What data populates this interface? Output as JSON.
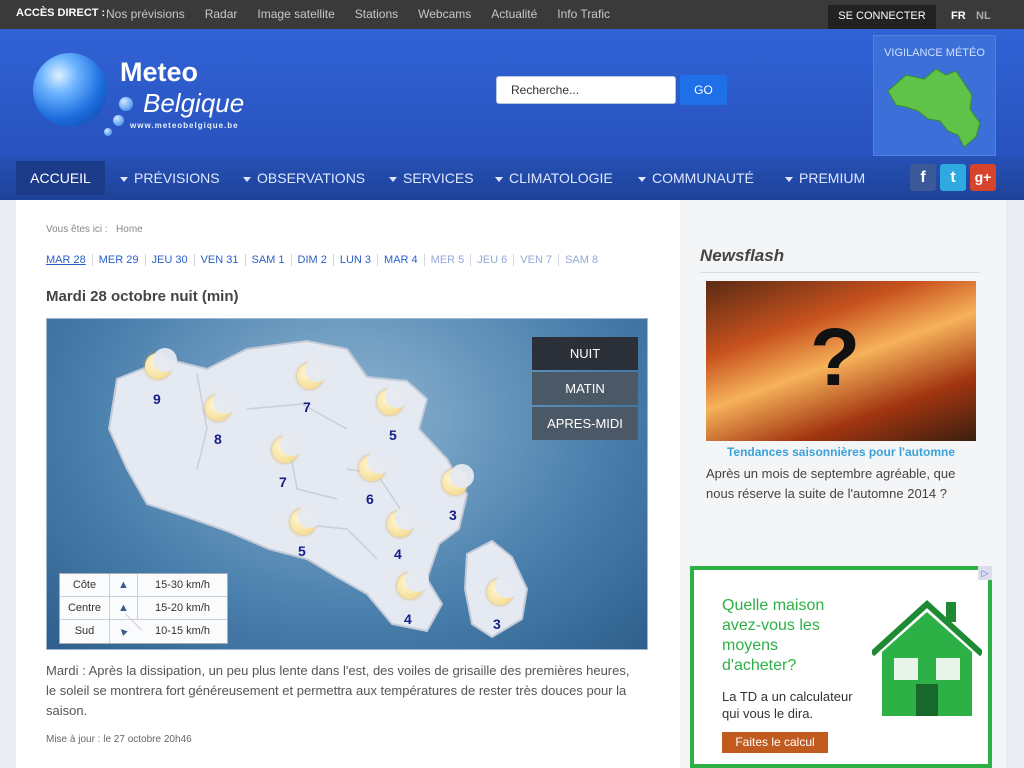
{
  "topbar": {
    "label": "ACCÈS DIRECT :",
    "links": [
      "Nos prévisions",
      "Radar",
      "Image satellite",
      "Stations",
      "Webcams",
      "Actualité",
      "Info Trafic"
    ],
    "login": "SE CONNECTER",
    "lang_fr": "FR",
    "lang_nl": "NL"
  },
  "header": {
    "logo_line1": "Meteo",
    "logo_line2": "Belgique",
    "logo_url": "www.meteobelgique.be",
    "search_placeholder": "Recherche...",
    "search_button": "GO",
    "vigilance": "VIGILANCE MÉTÉO"
  },
  "nav": {
    "home": "ACCUEIL",
    "items": [
      "PRÉVISIONS",
      "OBSERVATIONS",
      "SERVICES",
      "CLIMATOLOGIE",
      "COMMUNAUTÉ",
      "PREMIUM"
    ]
  },
  "breadcrumb": {
    "label": "Vous êtes ici :",
    "page": "Home"
  },
  "days": [
    "MAR 28",
    "MER 29",
    "JEU 30",
    "VEN 31",
    "SAM 1",
    "DIM 2",
    "LUN 3",
    "MAR 4",
    "MER 5",
    "JEU 6",
    "VEN 7",
    "SAM 8"
  ],
  "forecast": {
    "title": "Mardi 28 octobre nuit (min)",
    "tabs": [
      "NUIT",
      "MATIN",
      "APRES-MIDI"
    ],
    "temps": [
      "9",
      "8",
      "7",
      "7",
      "5",
      "6",
      "3",
      "5",
      "4",
      "4",
      "3"
    ],
    "wind": [
      {
        "zone": "Côte",
        "speed": "15-30 km/h"
      },
      {
        "zone": "Centre",
        "speed": "15-20 km/h"
      },
      {
        "zone": "Sud",
        "speed": "10-15 km/h"
      }
    ],
    "description": "Mardi : Après la dissipation, un peu plus lente dans l'est, des voiles de grisaille des premières heures, le soleil se montrera fort généreusement et permettra aux températures de rester très douces pour la saison.",
    "updated": "Mise à jour : le 27 octobre 20h46"
  },
  "newsflash": {
    "heading": "Newsflash",
    "link": "Tendances saisonnières pour l'automne",
    "text": "Après un mois de septembre agréable, que nous réserve la suite de l'automne 2014 ?"
  },
  "ad": {
    "headline": "Quelle maison avez-vous les moyens d'acheter?",
    "sub": "La TD a un calculateur qui vous le dira.",
    "button": "Faites le calcul"
  }
}
